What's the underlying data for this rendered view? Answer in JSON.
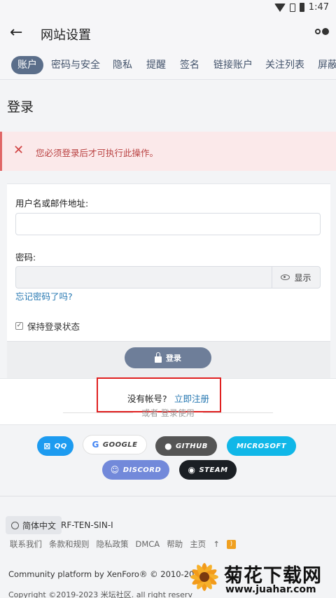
{
  "status_bar": {
    "time": "1:47"
  },
  "app_bar": {
    "title": "网站设置"
  },
  "tabs": [
    "账户",
    "密码与安全",
    "隐私",
    "提醒",
    "签名",
    "链接账户",
    "关注列表",
    "屏蔽"
  ],
  "page": {
    "title": "登录"
  },
  "alert": {
    "message": "您必须登录后才可执行此操作。"
  },
  "form": {
    "username_label": "用户名或邮件地址:",
    "username_value": "",
    "password_label": "密码:",
    "password_value": "",
    "show_label": "显示",
    "forgot_label": "忘记密码了吗?",
    "remember_label": "保持登录状态",
    "login_label": "登录"
  },
  "register": {
    "prompt": "没有帐号?",
    "link": "立即注册",
    "or_text": "或者 登录使用"
  },
  "social": [
    {
      "label": "QQ",
      "icon": "qq-icon",
      "color": "#1d9bf0"
    },
    {
      "label": "GOOGLE",
      "icon": "google-icon",
      "color": "#ffffff"
    },
    {
      "label": "GITHUB",
      "icon": "github-icon",
      "color": "#555555"
    },
    {
      "label": "MICROSOFT",
      "icon": "microsoft-icon",
      "color": "#10b7e8"
    },
    {
      "label": "DISCORD",
      "icon": "discord-icon",
      "color": "#7289da"
    },
    {
      "label": "STEAM",
      "icon": "steam-icon",
      "color": "#1b1f24"
    }
  ],
  "footer": {
    "language": "简体中文",
    "style": "RF-TEN-SIN-I",
    "links": [
      "联系我们",
      "条款和规则",
      "隐私政策",
      "DMCA",
      "帮助",
      "主页"
    ],
    "platform": "Community platform by XenForo® © 2010-2021",
    "copyright": "Copyright ©2019-2023 米坛社区. all right reserv"
  },
  "watermark": {
    "name": "菊花下载网",
    "url": "www.juahar.com"
  },
  "colors": {
    "accent": "#5b6e8a",
    "link": "#2577b1",
    "error": "#d14343",
    "highlight_box": "#e02020"
  }
}
